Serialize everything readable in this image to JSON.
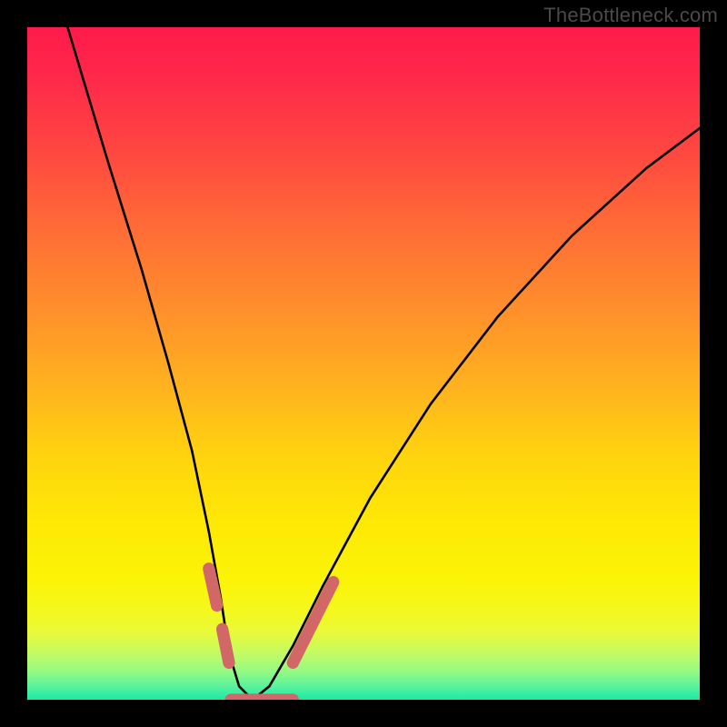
{
  "watermark": "TheBottleneck.com",
  "chart_data": {
    "type": "line",
    "title": "",
    "xlabel": "",
    "ylabel": "",
    "xlim": [
      0,
      1
    ],
    "ylim": [
      0,
      1
    ],
    "note": "No numeric axes or tick labels are present in the image; values are normalized 0–1 estimates read from the geometry.",
    "series": [
      {
        "name": "bottleneck-curve-main",
        "color": "#000000",
        "x": [
          0.06,
          0.12,
          0.17,
          0.21,
          0.245,
          0.27,
          0.288,
          0.3,
          0.315,
          0.335,
          0.36,
          0.395,
          0.44,
          0.51,
          0.6,
          0.7,
          0.81,
          0.92,
          1.0
        ],
        "y": [
          1.0,
          0.8,
          0.64,
          0.5,
          0.37,
          0.25,
          0.15,
          0.07,
          0.02,
          0.0,
          0.02,
          0.08,
          0.17,
          0.3,
          0.44,
          0.57,
          0.69,
          0.79,
          0.85
        ]
      },
      {
        "name": "highlight-segments",
        "color": "#d16767",
        "stroke_width_relative": 0.018,
        "segments": [
          {
            "x": [
              0.27,
              0.282
            ],
            "y": [
              0.195,
              0.14
            ]
          },
          {
            "x": [
              0.29,
              0.3
            ],
            "y": [
              0.105,
              0.055
            ]
          },
          {
            "x": [
              0.303,
              0.395
            ],
            "y": [
              0.0,
              0.0
            ]
          },
          {
            "x": [
              0.395,
              0.455
            ],
            "y": [
              0.055,
              0.175
            ]
          }
        ]
      }
    ]
  }
}
